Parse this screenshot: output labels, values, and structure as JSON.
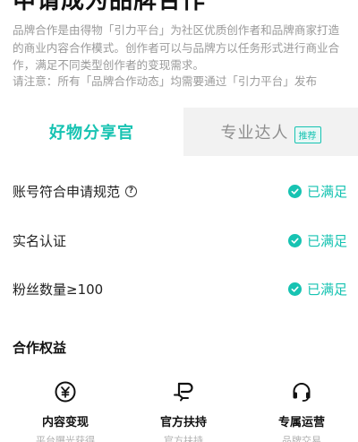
{
  "header": {
    "title": "申请成为品牌合作"
  },
  "intro": {
    "description": "品牌合作是由得物「引力平台」为社区优质创作者和品牌商家打造的商业内容合作模式。创作者可以与品牌方以任务形式进行商业合作，满足不同类型创作者的变现需求。",
    "notice": "请注意：所有「品牌合作动态」均需要通过「引力平台」发布"
  },
  "tabs": [
    {
      "label": "好物分享官",
      "active": true
    },
    {
      "label": "专业达人",
      "active": false,
      "badge": "推荐"
    }
  ],
  "requirements": [
    {
      "label": "账号符合申请规范",
      "status": "已满足",
      "has_help": true
    },
    {
      "label": "实名认证",
      "status": "已满足"
    },
    {
      "label": "粉丝数量≥100",
      "status": "已满足"
    }
  ],
  "benefits_section": {
    "title": "合作权益",
    "items": [
      {
        "icon": "yen-coin-icon",
        "name": "内容变现",
        "sub": "平台曝光获得"
      },
      {
        "icon": "support-hand-icon",
        "name": "官方扶持",
        "sub": "官方扶持"
      },
      {
        "icon": "headset-icon",
        "name": "专属运营",
        "sub": "品牌交易"
      }
    ]
  },
  "colors": {
    "accent": "#17c3b2",
    "muted_text": "#9a9a9a",
    "tab_inactive_bg": "#f2f2f2"
  }
}
